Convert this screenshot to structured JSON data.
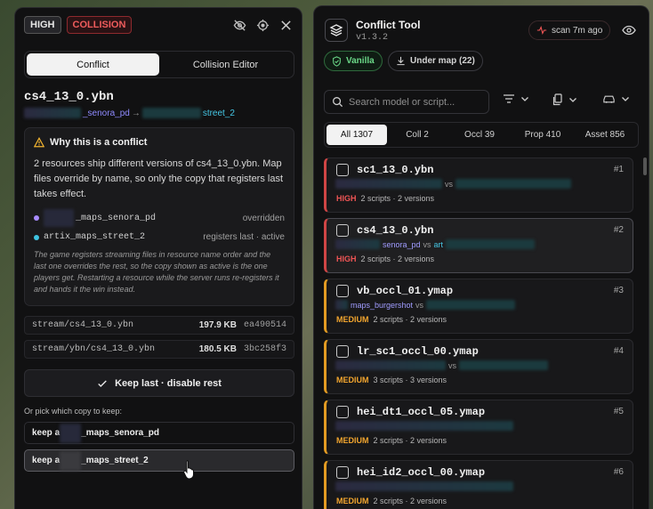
{
  "left": {
    "badges": {
      "high": "HIGH",
      "collision": "COLLISION"
    },
    "tabs": {
      "conflict": "Conflict",
      "editor": "Collision Editor"
    },
    "file_title": "cs4_13_0.ybn",
    "path_from": "_senora_pd",
    "path_arrow": "→",
    "path_to": "street_2",
    "why": {
      "title": "Why this is a conflict",
      "text": "2 resources ship different versions of cs4_13_0.ybn. Map files override by name, so only the copy that registers last takes effect.",
      "res1_name": "_maps_senora_pd",
      "res1_status": "overridden",
      "res2_name": "artix_maps_street_2",
      "res2_status": "registers last · active",
      "note": "The game registers streaming files in resource name order and the last one overrides the rest, so the copy shown as active is the one players get. Restarting a resource while the server runs re-registers it and hands it the win instead."
    },
    "files": [
      {
        "path": "stream/cs4_13_0.ybn",
        "size": "197.9 KB",
        "hash": "ea490514"
      },
      {
        "path": "stream/ybn/cs4_13_0.ybn",
        "size": "180.5 KB",
        "hash": "3bc258f3"
      }
    ],
    "keep_last": "Keep last · disable rest",
    "pick_label": "Or pick which copy to keep:",
    "pick1_pre": "keep a",
    "pick1_post": "_maps_senora_pd",
    "pick2_pre": "keep a",
    "pick2_post": "_maps_street_2"
  },
  "right": {
    "title": "Conflict Tool",
    "version": "v1.3.2",
    "scan": "scan 7m ago",
    "chip_vanilla": "Vanilla",
    "chip_under": "Under map (22)",
    "search_placeholder": "Search model or script...",
    "tabs": [
      "All 1307",
      "Coll 2",
      "Occl 39",
      "Prop 410",
      "Asset 856"
    ],
    "cards": [
      {
        "name": "sc1_13_0.ybn",
        "num": "#1",
        "sev": "HIGH",
        "a": "",
        "b": "",
        "meta": "2 scripts · 2 versions"
      },
      {
        "name": "cs4_13_0.ybn",
        "num": "#2",
        "sev": "HIGH",
        "a": "senora_pd",
        "b": "art",
        "meta": "2 scripts · 2 versions"
      },
      {
        "name": "vb_occl_01.ymap",
        "num": "#3",
        "sev": "MEDIUM",
        "a": "maps_burgershot",
        "b": "",
        "meta": "2 scripts · 2 versions"
      },
      {
        "name": "lr_sc1_occl_00.ymap",
        "num": "#4",
        "sev": "MEDIUM",
        "a": "",
        "b": "",
        "meta": "3 scripts · 3 versions"
      },
      {
        "name": "hei_dt1_occl_05.ymap",
        "num": "#5",
        "sev": "MEDIUM",
        "a": "",
        "b": "",
        "meta": "2 scripts · 2 versions"
      },
      {
        "name": "hei_id2_occl_00.ymap",
        "num": "#6",
        "sev": "MEDIUM",
        "a": "",
        "b": "",
        "meta": "2 scripts · 2 versions"
      }
    ]
  }
}
